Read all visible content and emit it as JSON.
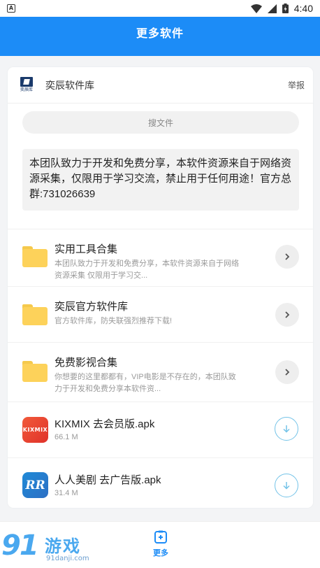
{
  "status_bar": {
    "badge": "A",
    "time": "4:40"
  },
  "app_bar": {
    "title": "更多软件"
  },
  "card": {
    "header": {
      "logo_text": "奕辰库",
      "title": "奕辰软件库",
      "report_label": "举报"
    },
    "search": {
      "placeholder": "搜文件"
    },
    "notice": {
      "text": "本团队致力于开发和免费分享，本软件资源来自于网络资源采集，仅限用于学习交流，禁止用于任何用途！官方总群:731026639"
    },
    "folders": [
      {
        "title": "实用工具合集",
        "desc": "本团队致力于开发和免费分享，本软件资源来自于网络资源采集 仅限用于学习交..."
      },
      {
        "title": "奕辰官方软件库",
        "desc": "官方软件库，防失联强烈推荐下载!"
      },
      {
        "title": "免费影视合集",
        "desc": "你想要的这里都都有，VIP电影是不存在的，本团队致力于开发和免费分享本软件资..."
      }
    ],
    "files": [
      {
        "icon_label": "KIXMIX",
        "title": "KIXMIX 去会员版.apk",
        "size": "66.1 M"
      },
      {
        "icon_label": "RR",
        "title": "人人美剧 去广告版.apk",
        "size": "31.4 M"
      }
    ]
  },
  "bottom_nav": {
    "more_label": "更多"
  },
  "watermark": {
    "number": "91",
    "brand": "游戏",
    "url": "91danji.com"
  },
  "colors": {
    "primary": "#1c8cf7",
    "folder": "#fdd25a",
    "download_ring": "#74c3e8"
  }
}
